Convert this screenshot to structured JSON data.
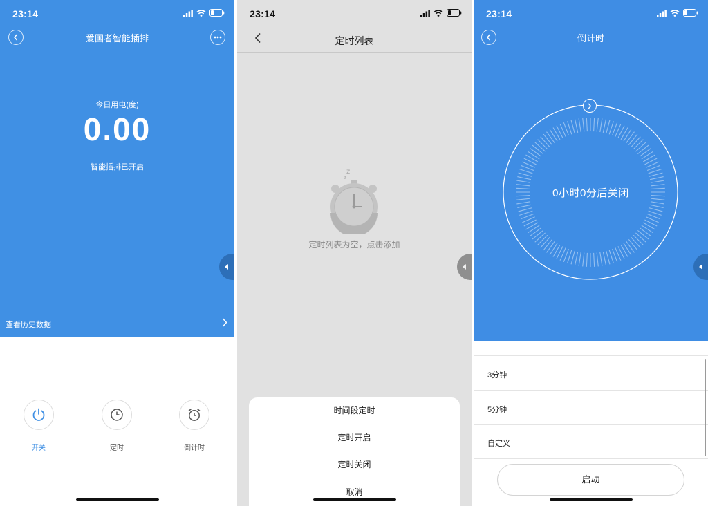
{
  "status_bar": {
    "time": "23:14"
  },
  "panel1": {
    "title": "爱国者智能插排",
    "energy_label": "今日用电(度)",
    "energy_value": "0.00",
    "status_text": "智能插排已开启",
    "history_link": "查看历史数据",
    "controls": [
      {
        "label": "开关",
        "icon": "power-icon"
      },
      {
        "label": "定时",
        "icon": "clock-icon"
      },
      {
        "label": "倒计时",
        "icon": "alarm-clock-icon"
      }
    ],
    "colors": {
      "primary": "#4090e4",
      "active_label": "#4090e4"
    }
  },
  "panel2": {
    "title": "定时列表",
    "empty_text": "定时列表为空，点击添加",
    "sheet_options": [
      "时间段定时",
      "定时开启",
      "定时关闭",
      "取消"
    ],
    "colors": {
      "background": "#e1e1e1"
    }
  },
  "panel3": {
    "title": "倒计时",
    "countdown_text": "0小时0分后关闭",
    "options": [
      "3分钟",
      "5分钟",
      "自定义"
    ],
    "start_button": "启动",
    "colors": {
      "primary": "#3f8de4"
    }
  }
}
